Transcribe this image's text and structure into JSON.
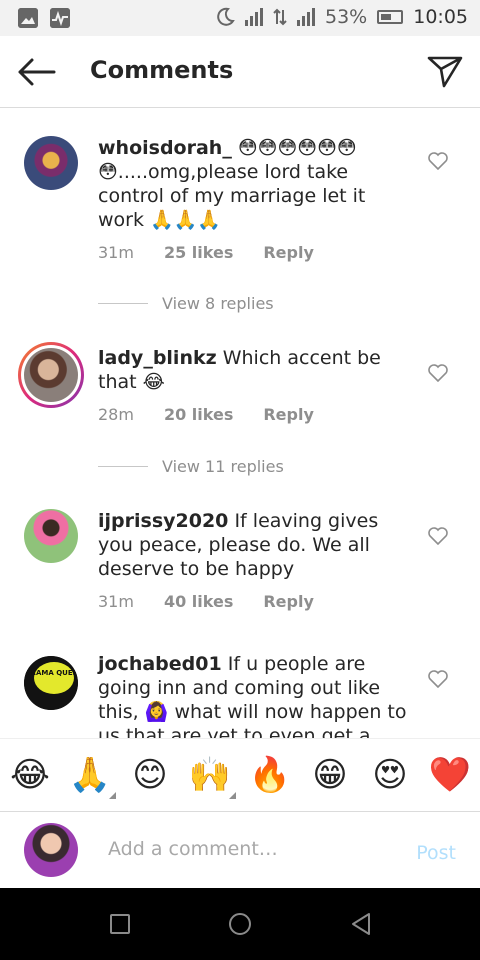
{
  "status_bar": {
    "battery": "53%",
    "time": "10:05"
  },
  "header": {
    "title": "Comments"
  },
  "comments": [
    {
      "username": "whoisdorah_",
      "text": "😳😳😳😳😳😳😳.....omg,please lord take control of my marriage let it work 🙏🙏🙏",
      "time": "31m",
      "likes": "25 likes",
      "reply": "Reply",
      "view_replies": "View 8 replies"
    },
    {
      "username": "lady_blinkz",
      "text": "Which accent be that 😂",
      "time": "28m",
      "likes": "20 likes",
      "reply": "Reply",
      "view_replies": "View 11 replies"
    },
    {
      "username": "ijprissy2020",
      "text": "If leaving gives you peace, please do. We all deserve to be happy",
      "time": "31m",
      "likes": "40 likes",
      "reply": "Reply"
    },
    {
      "username": "jochabed01",
      "text": "If u people are going inn and coming out like this, 🙆‍♀️ what will now happen to us that are yet to even get a",
      "avatar_text": "DRAMA QUEEN"
    }
  ],
  "emoji_bar": [
    "😂",
    "🙏",
    "😊",
    "🙌",
    "🔥",
    "😁",
    "😍",
    "❤️"
  ],
  "input": {
    "placeholder": "Add a comment…",
    "post_label": "Post"
  },
  "colors": {
    "muted": "#8e8e8e",
    "post_disabled": "#b2dffc",
    "story_ring": "#dd2a7b"
  }
}
